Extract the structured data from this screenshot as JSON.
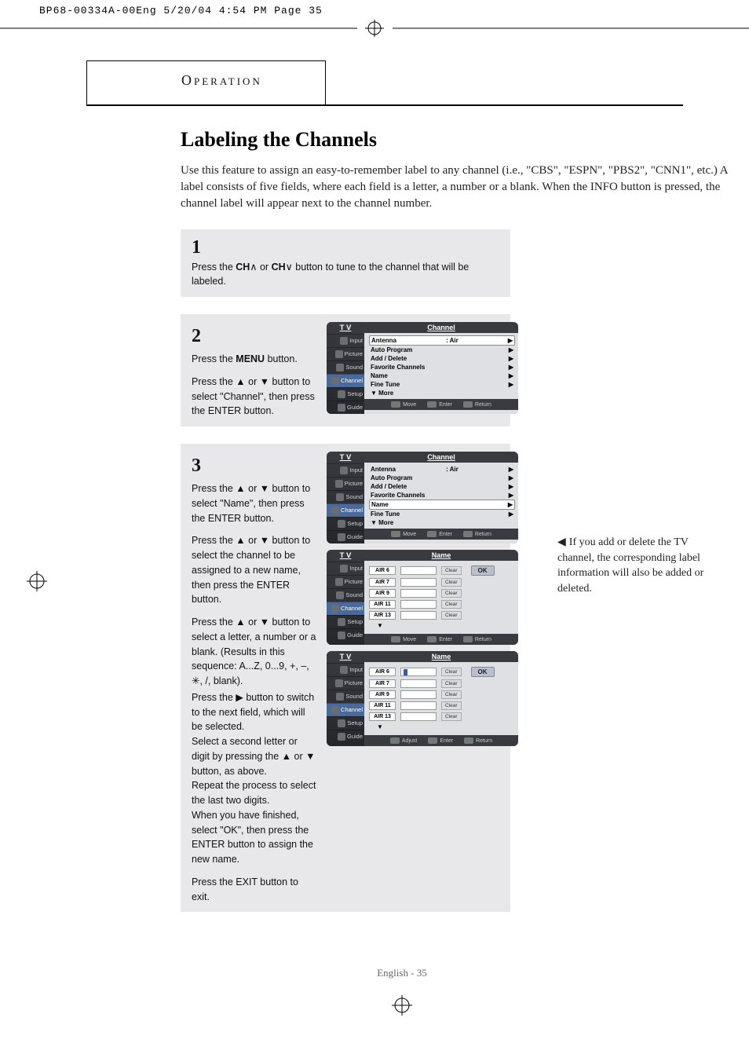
{
  "pressrun": "BP68-00334A-00Eng  5/20/04  4:54 PM  Page 35",
  "operation_label": "Operation",
  "section_title": "Labeling the Channels",
  "intro": "Use this feature to assign an easy-to-remember label to any channel (i.e., \"CBS\", \"ESPN\", \"PBS2\", \"CNN1\", etc.) A label consists of five fields, where each field is a letter, a number or a blank. When the INFO button is pressed, the channel label will appear next to the channel number.",
  "steps": {
    "s1": {
      "num": "1",
      "text_parts": [
        "Press the ",
        "CH",
        " or ",
        "CH",
        " button to tune to the channel that will be labeled."
      ]
    },
    "s2": {
      "num": "2",
      "p1_a": "Press the ",
      "p1_b": "MENU",
      "p1_c": " button.",
      "p2": "Press the ▲ or ▼ button to select \"Channel\", then press the ENTER button."
    },
    "s3": {
      "num": "3",
      "p1": "Press the ▲ or ▼ button to select \"Name\", then press the ENTER button.",
      "p2": "Press the ▲ or ▼ button to select the channel to be assigned to a new name, then press the ENTER button.",
      "p3": "Press the ▲ or ▼ button to select a letter, a number or a blank. (Results in this sequence: A...Z, 0...9, +, –, ✳, /, blank).",
      "p4": "Press the ▶ button to switch to the next field, which will be selected.",
      "p5": "Select a second letter or digit by pressing the ▲ or ▼ button, as above.",
      "p6": "Repeat the process to select the last two digits.",
      "p7": "When you have finished, select \"OK\", then press the ENTER button to assign the new name.",
      "p8": "Press the EXIT button to exit."
    }
  },
  "side_note": "If you add or delete the TV channel, the corresponding label information will also be added or deleted.",
  "tv": {
    "brand": "T V",
    "side_items": [
      "Input",
      "Picture",
      "Sound",
      "Channel",
      "Setup",
      "Guide"
    ],
    "channel_title": "Channel",
    "name_title": "Name",
    "menu_rows": [
      {
        "label": "Antenna",
        "value": ":  Air"
      },
      {
        "label": "Auto Program",
        "value": ""
      },
      {
        "label": "Add / Delete",
        "value": ""
      },
      {
        "label": "Favorite Channels",
        "value": ""
      },
      {
        "label": "Name",
        "value": ""
      },
      {
        "label": "Fine Tune",
        "value": ""
      }
    ],
    "more": "▼ More",
    "foot_move": "Move",
    "foot_enter": "Enter",
    "foot_return": "Return",
    "foot_adjust": "Adjust",
    "name_rows": [
      "AIR 6",
      "AIR 7",
      "AIR 9",
      "AIR 11",
      "AIR 13"
    ],
    "clear": "Clear",
    "ok": "OK"
  },
  "footer": "English - 35"
}
